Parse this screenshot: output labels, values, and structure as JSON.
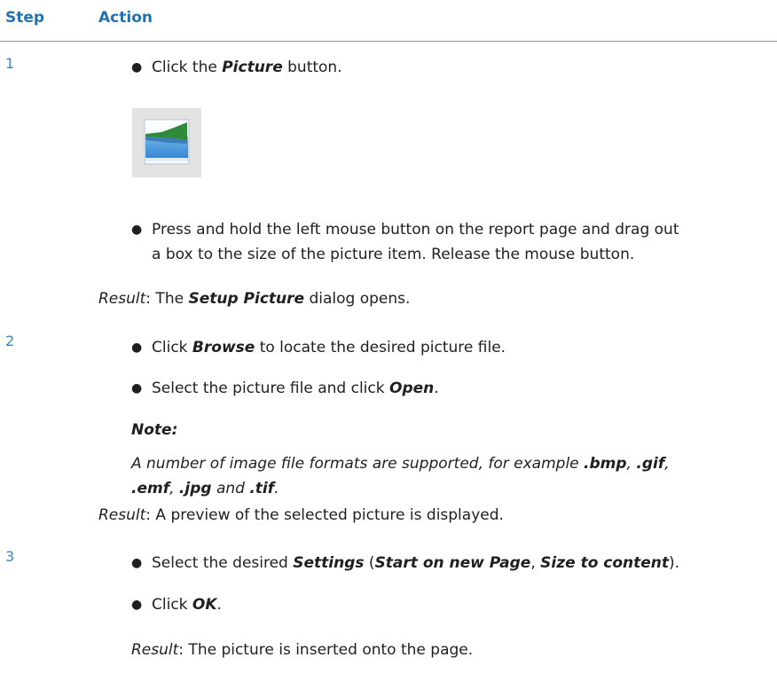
{
  "header": {
    "step": "Step",
    "action": "Action"
  },
  "steps": [
    {
      "number": "1",
      "b1": {
        "pre": "Click the ",
        "bold": "Picture",
        "post": " button."
      },
      "picture_icon": "picture-button-icon",
      "b2": {
        "line1": "Press and hold the left mouse button on the report page and drag out",
        "line2": "a box to the size of the picture item. Release the mouse button."
      },
      "result": {
        "label": "Result",
        "pre": ": The ",
        "bold": "Setup Picture",
        "post": " dialog opens."
      }
    },
    {
      "number": "2",
      "b1": {
        "pre": "Click ",
        "bold": "Browse",
        "post": " to locate the desired picture file."
      },
      "b2": {
        "pre": "Select the picture file and click ",
        "bold": "Open",
        "post": "."
      },
      "note": {
        "title": "Note:",
        "line1_pre": "A number of image file formats are supported, for example ",
        "bmp": ".bmp",
        "sep1": ", ",
        "gif": ".gif",
        "sep2": ",",
        "emf": ".emf",
        "sep3": ", ",
        "jpg": ".jpg",
        "and": " and ",
        "tif": ".tif",
        "end": "."
      },
      "result": {
        "label": "Result",
        "text": ": A preview of the selected picture is displayed."
      }
    },
    {
      "number": "3",
      "b1": {
        "pre": "Select the desired ",
        "settings": "Settings",
        "open_paren": " (",
        "start": "Start on new Page",
        "comma": ", ",
        "size": "Size to content",
        "close": ")."
      },
      "b2": {
        "pre": "Click ",
        "bold": "OK",
        "post": "."
      },
      "result": {
        "label": "Result",
        "text": ": The picture is inserted onto the page."
      }
    }
  ],
  "colors": {
    "heading": "#2372b0",
    "rule": "#6a9fcc",
    "step_number": "#3a85c4"
  }
}
